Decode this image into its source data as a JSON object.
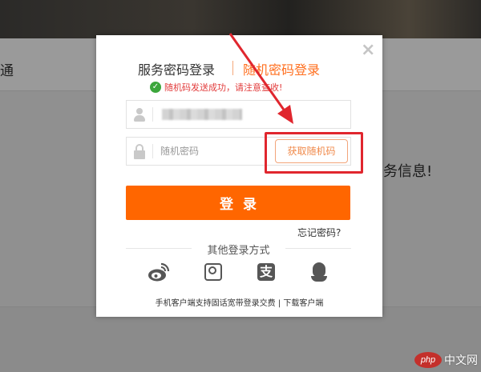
{
  "background": {
    "nav_text": "通",
    "message_text": "务信息!"
  },
  "dialog": {
    "close_label": "×",
    "tabs": {
      "service": "服务密码登录",
      "random": "随机密码登录"
    },
    "notice": {
      "check_glyph": "✓",
      "text": "随机码发送成功，请注意查收!"
    },
    "username_field": {
      "value": "████████"
    },
    "code_field": {
      "placeholder": "随机密码",
      "get_code_button": "获取随机码"
    },
    "login_button": "登录",
    "forgot_password": "忘记密码?",
    "other_login_title": "其他登录方式",
    "social_icons": [
      "weibo-icon",
      "p-icon",
      "alipay-icon",
      "qq-icon"
    ],
    "alipay_glyph": "支",
    "footer": {
      "text": "手机客户端支持固话宽带登录交费",
      "separator": " | ",
      "download_link": "下载客户端"
    }
  },
  "watermark": {
    "php": "php",
    "site": "中文网"
  },
  "colors": {
    "accent": "#ff6600",
    "highlight": "#e0262e",
    "notice_text": "#e23c3c",
    "success": "#3ca63c"
  }
}
